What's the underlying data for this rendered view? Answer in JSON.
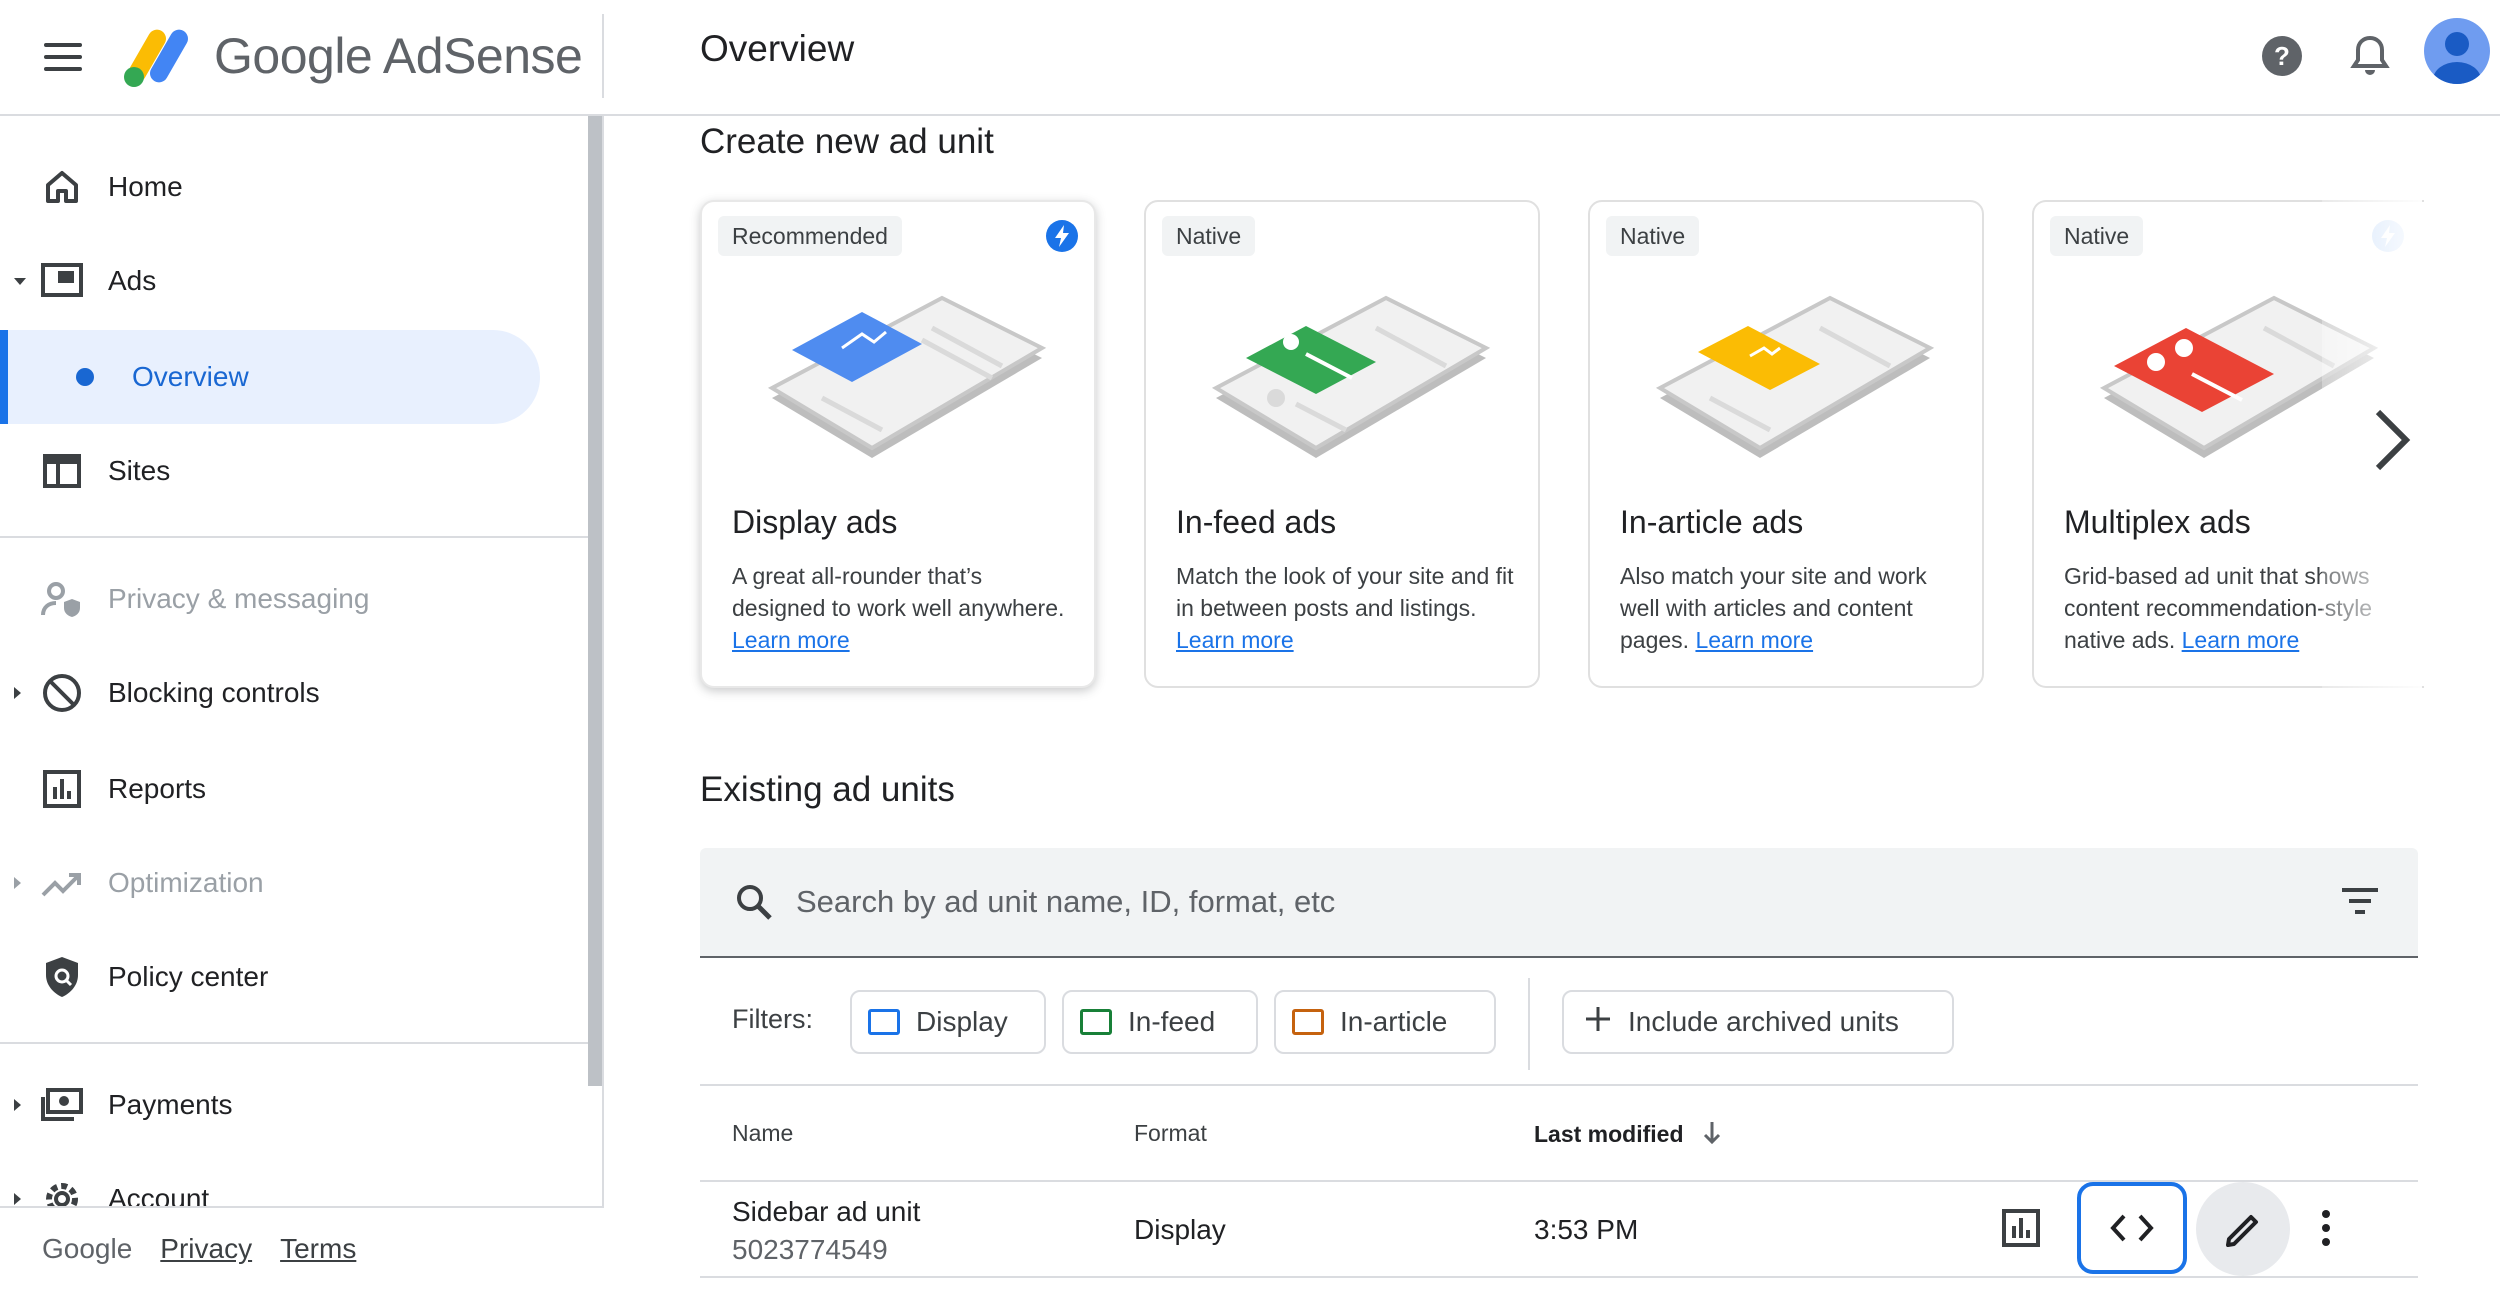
{
  "header": {
    "logo_google": "Google",
    "logo_product": "AdSense",
    "page_title": "Overview",
    "icons": [
      "menu-icon",
      "help-icon",
      "notifications-icon",
      "account-avatar"
    ]
  },
  "sidebar": {
    "items": [
      {
        "label": "Home",
        "icon": "home-icon"
      },
      {
        "label": "Ads",
        "icon": "ads-icon"
      },
      {
        "label": "Overview",
        "icon": "dot"
      },
      {
        "label": "Sites",
        "icon": "sites-icon"
      },
      {
        "label": "Privacy & messaging",
        "icon": "privacy-icon"
      },
      {
        "label": "Blocking controls",
        "icon": "block-icon"
      },
      {
        "label": "Reports",
        "icon": "reports-icon"
      },
      {
        "label": "Optimization",
        "icon": "trending-icon"
      },
      {
        "label": "Policy center",
        "icon": "policy-icon"
      },
      {
        "label": "Payments",
        "icon": "payments-icon"
      },
      {
        "label": "Account",
        "icon": "gear-icon"
      }
    ],
    "footer": {
      "google": "Google",
      "privacy": "Privacy",
      "terms": "Terms"
    }
  },
  "create": {
    "title": "Create new ad unit",
    "cards": [
      {
        "badge": "Recommended",
        "title": "Display ads",
        "desc": "A great all-rounder that’s designed to work well anywhere.",
        "link": "Learn more",
        "color": "#4f8cf0"
      },
      {
        "badge": "Native",
        "title": "In-feed ads",
        "desc": "Match the look of your site and fit in between posts and listings.",
        "link": "Learn more",
        "color": "#34a853"
      },
      {
        "badge": "Native",
        "title": "In-article ads",
        "desc": "Also match your site and work well with articles and content pages.",
        "link": "Learn more",
        "color": "#fbbc04"
      },
      {
        "badge": "Native",
        "title": "Multiplex ads",
        "desc": "Grid-based ad unit that shows content recommendation-style native ads.",
        "link": "Learn more",
        "color": "#ea4335"
      }
    ]
  },
  "existing": {
    "title": "Existing ad units",
    "search_placeholder": "Search by ad unit name, ID, format, etc",
    "filters_label": "Filters:",
    "chips": [
      {
        "label": "Display",
        "color": "#1a73e8"
      },
      {
        "label": "In-feed",
        "color": "#188038"
      },
      {
        "label": "In-article",
        "color": "#c5620e"
      }
    ],
    "archived_chip": "Include archived units",
    "columns": {
      "name": "Name",
      "format": "Format",
      "last_modified": "Last modified"
    },
    "rows": [
      {
        "name": "Sidebar ad unit",
        "id": "5023774549",
        "format": "Display",
        "modified": "3:53 PM"
      }
    ]
  }
}
